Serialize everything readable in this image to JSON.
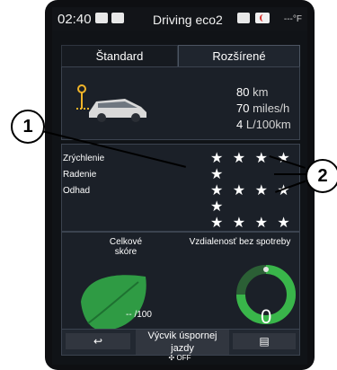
{
  "status": {
    "time": "02:40",
    "title": "Driving eco2",
    "temperature": "---°F"
  },
  "tabs": [
    {
      "label": "Štandard"
    },
    {
      "label": "Rozšírené"
    }
  ],
  "trip": {
    "distance": {
      "value": "80",
      "unit": "km"
    },
    "speed": {
      "value": "70",
      "unit": "miles/h"
    },
    "consumption": {
      "value": "4",
      "unit": "L/100km"
    }
  },
  "ratings": [
    {
      "label": "Zrýchlenie",
      "stars": "★ ★ ★ ★ ★"
    },
    {
      "label": "Radenie",
      "stars": "★ ★ ★ ★ ★"
    },
    {
      "label": "Odhad",
      "stars": "★ ★ ★ ★ ★"
    }
  ],
  "overall": {
    "title_line1": "Celkové",
    "title_line2": "skóre",
    "score": "-- /100"
  },
  "distance_without": {
    "title": "Vzdialenosť bez spotreby",
    "value": "0"
  },
  "bottom": {
    "center_line1": "Výcvik úspornej",
    "center_line2": "jazdy",
    "footer": "OFF"
  },
  "callouts": {
    "one": "1",
    "two": "2"
  },
  "colors": {
    "leaf": "#2f9b44",
    "gauge": "#39b54a"
  }
}
